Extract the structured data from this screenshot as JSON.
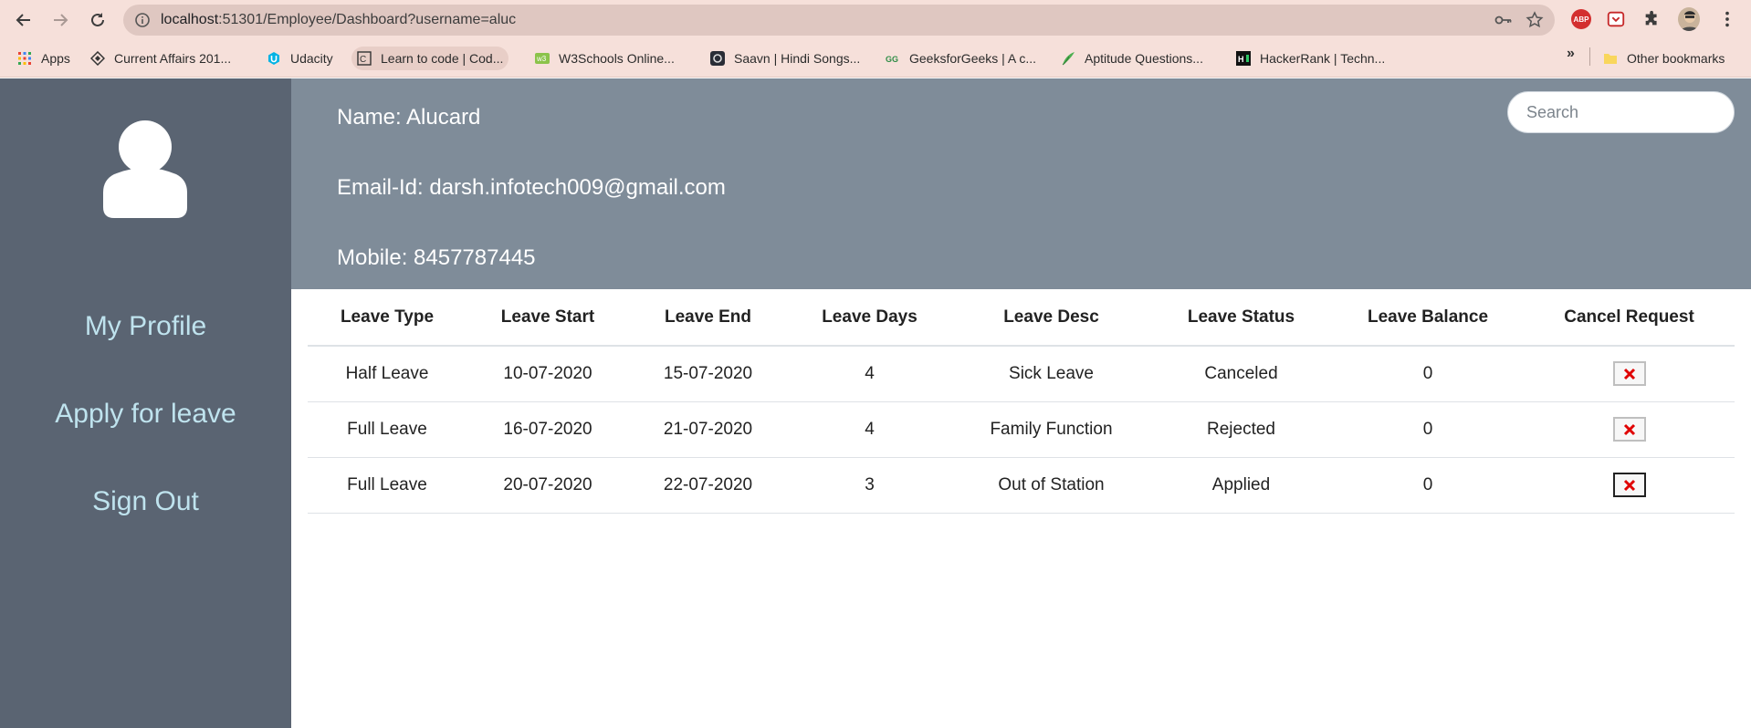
{
  "browser": {
    "url_host": "localhost",
    "url_rest": ":51301/Employee/Dashboard?username=aluc",
    "bookmarks": [
      {
        "label": "Apps",
        "icon": "apps-grid-icon"
      },
      {
        "label": "Current Affairs 201...",
        "icon": "current-affairs-icon"
      },
      {
        "label": "Udacity",
        "icon": "udacity-icon"
      },
      {
        "label": "Learn to code | Cod...",
        "icon": "codecademy-icon"
      },
      {
        "label": "W3Schools Online...",
        "icon": "w3schools-icon"
      },
      {
        "label": "Saavn | Hindi Songs...",
        "icon": "saavn-icon"
      },
      {
        "label": "GeeksforGeeks | A c...",
        "icon": "geeksforgeeks-icon"
      },
      {
        "label": "Aptitude Questions...",
        "icon": "indiabix-icon"
      },
      {
        "label": "HackerRank | Techn...",
        "icon": "hackerrank-icon"
      }
    ],
    "more_bookmarks": "»",
    "other_bookmarks": "Other bookmarks",
    "abp_label": "ABP"
  },
  "sidebar": {
    "items": [
      {
        "label": "My Profile"
      },
      {
        "label": "Apply for leave"
      },
      {
        "label": "Sign Out"
      }
    ]
  },
  "header": {
    "name": "Name: Alucard",
    "email": "Email-Id: darsh.infotech009@gmail.com",
    "mobile": "Mobile: 8457787445",
    "search_placeholder": "Search"
  },
  "table": {
    "columns": [
      "Leave Type",
      "Leave Start",
      "Leave End",
      "Leave Days",
      "Leave Desc",
      "Leave Status",
      "Leave Balance",
      "Cancel Request"
    ],
    "rows": [
      [
        "Half Leave",
        "10-07-2020",
        "15-07-2020",
        "4",
        "Sick Leave",
        "Canceled",
        "0"
      ],
      [
        "Full Leave",
        "16-07-2020",
        "21-07-2020",
        "4",
        "Family Function",
        "Rejected",
        "0"
      ],
      [
        "Full Leave",
        "20-07-2020",
        "22-07-2020",
        "3",
        "Out of Station",
        "Applied",
        "0"
      ]
    ]
  },
  "colors": {
    "sidebar_bg": "#5a6472",
    "header_bg": "#7f8c99",
    "link_color": "#bfe3ee",
    "cancel_icon": "#e00000"
  }
}
